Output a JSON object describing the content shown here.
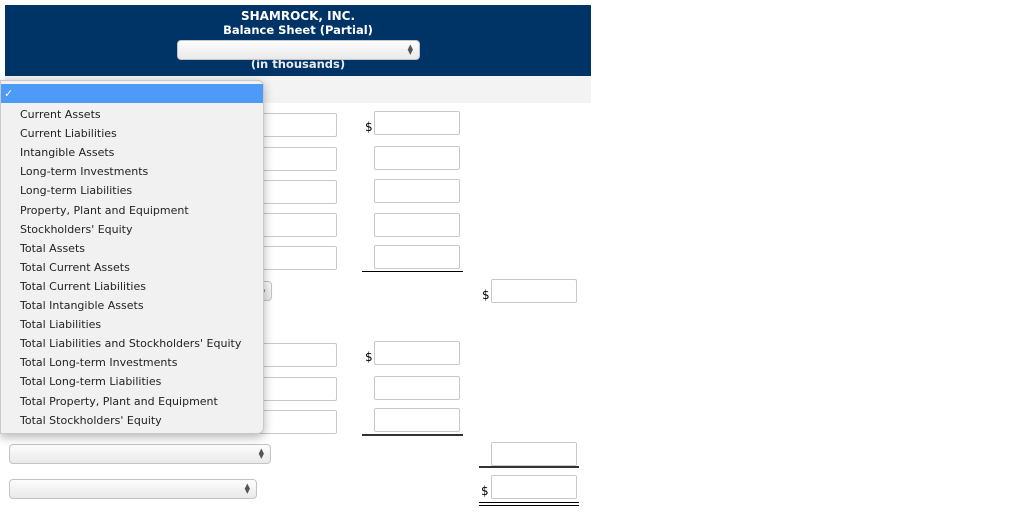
{
  "header": {
    "company": "SHAMROCK, INC.",
    "title": "Balance Sheet (Partial)",
    "date_select_value": "",
    "units": "(in thousands)"
  },
  "dropdown": {
    "selected_check": "✓",
    "options": [
      "Current Assets",
      "Current Liabilities",
      "Intangible Assets",
      "Long-term Investments",
      "Long-term Liabilities",
      "Property, Plant and Equipment",
      "Stockholders' Equity",
      "Total Assets",
      "Total Current Assets",
      "Total Current Liabilities",
      "Total Intangible Assets",
      "Total Liabilities",
      "Total Liabilities and Stockholders' Equity",
      "Total Long-term Investments",
      "Total Long-term Liabilities",
      "Total Property, Plant and Equipment",
      "Total Stockholders' Equity"
    ]
  },
  "form": {
    "currency_symbol": "$",
    "section1_rows": [
      "",
      "",
      "",
      "",
      ""
    ],
    "section1_total_select": "",
    "section1_total_value": "",
    "section2_rows": [
      "",
      "",
      ""
    ],
    "section2_total_select": "",
    "section2_total_value": "",
    "grand_total_select": "",
    "grand_total_value": ""
  }
}
